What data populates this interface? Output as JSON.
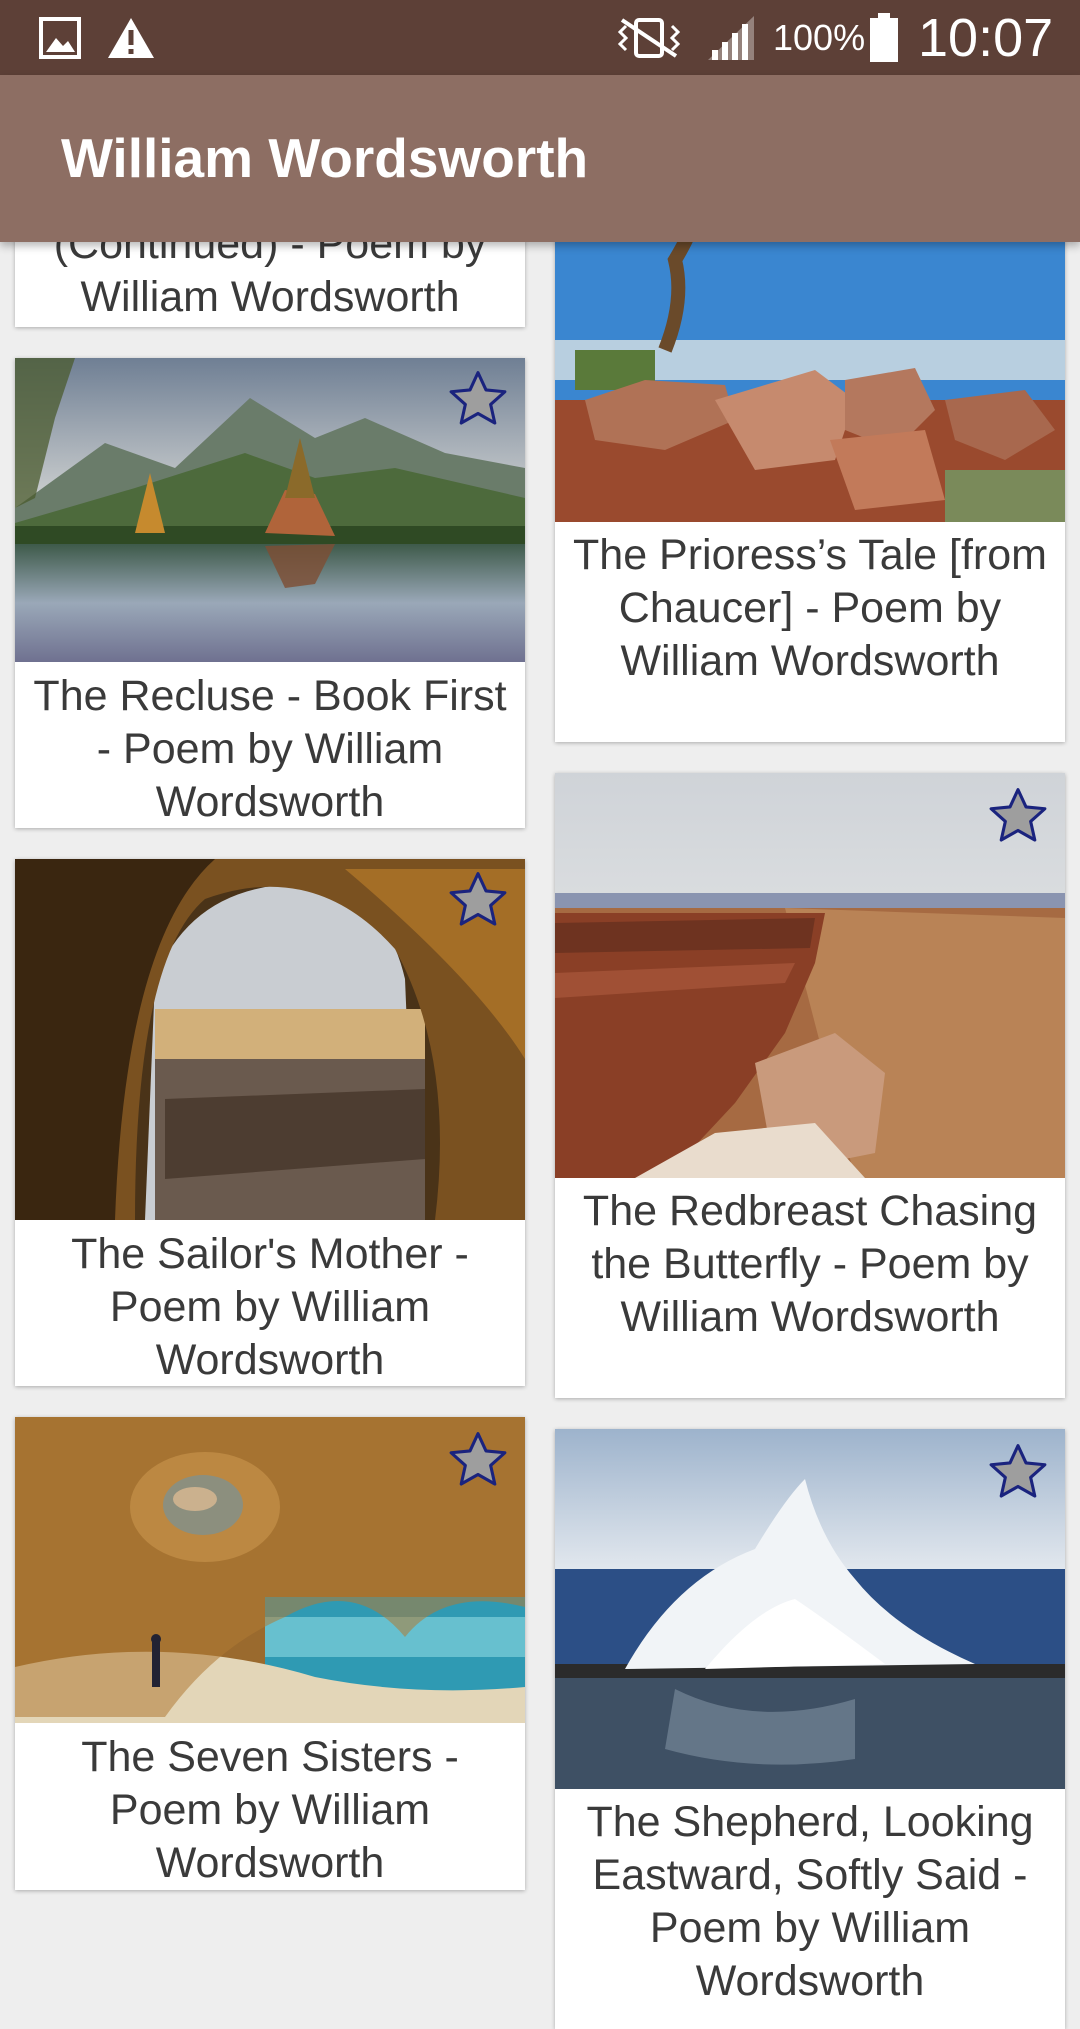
{
  "status_bar": {
    "battery": "100%",
    "time": "10:07",
    "icons": [
      "gallery-icon",
      "warning-icon",
      "vibrate-mute-icon",
      "signal-icon",
      "battery-icon"
    ]
  },
  "app_bar": {
    "title": "William Wordsworth"
  },
  "poems": [
    {
      "title": "(Continued) - Poem by William Wordsworth"
    },
    {
      "title": "The Recluse - Book First - Poem by William Wordsworth",
      "image": "mountain-lake-photo",
      "favorite": false
    },
    {
      "title": "The Sailor's Mother - Poem by William Wordsworth",
      "image": "sea-cave-photo",
      "favorite": false
    },
    {
      "title": "The Seven Sisters - Poem by William Wordsworth",
      "image": "beach-cave-photo",
      "favorite": false
    },
    {
      "title": "The Prioress’s Tale [from Chaucer] - Poem by William Wordsworth",
      "image": "desert-rocks-photo"
    },
    {
      "title": "The Redbreast Chasing the Butterfly - Poem by William Wordsworth",
      "image": "canyon-cliff-photo",
      "favorite": false
    },
    {
      "title": "The Shepherd, Looking Eastward, Softly Said - Poem by William Wordsworth",
      "image": "ocean-splash-photo",
      "favorite": false
    }
  ],
  "colors": {
    "status_bar": "#5d4037",
    "app_bar": "#8d6e63",
    "background": "#eeeeee",
    "card": "#ffffff",
    "star_fill": "#9e9e9e",
    "star_outline": "#1a237e"
  }
}
